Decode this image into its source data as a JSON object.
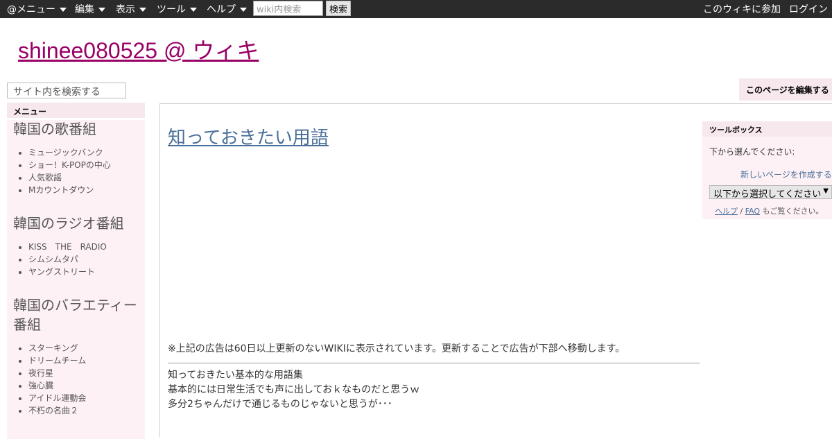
{
  "topbar": {
    "menus": [
      {
        "label": "@メニュー"
      },
      {
        "label": "編集"
      },
      {
        "label": "表示"
      },
      {
        "label": "ツール"
      },
      {
        "label": "ヘルプ"
      }
    ],
    "search_placeholder": "wiki内検索",
    "search_button": "検索",
    "join_label": "このウィキに参加",
    "login_label": "ログイン"
  },
  "site": {
    "title": "shinee080525 @ ウィキ"
  },
  "left_search": {
    "placeholder": "サイト内を検索する"
  },
  "edit_tab": {
    "label": "このページを編集する"
  },
  "sidebar": {
    "menu_label": "メニュー",
    "sections": [
      {
        "heading": "韓国の歌番組",
        "items": [
          "ミュージックバンク",
          "ショー！K-POPの中心",
          "人気歌謡",
          "Mカウントダウン"
        ]
      },
      {
        "heading": "韓国のラジオ番組",
        "items": [
          "KISS　THE　RADIO",
          "シムシムタパ",
          "ヤングストリート"
        ]
      },
      {
        "heading_line1": "韓国のバラエティー",
        "heading_line2": "番組",
        "items": [
          "スターキング",
          "ドリームチーム",
          "夜行星",
          "強心臓",
          "アイドル運動会",
          "不朽の名曲２"
        ]
      }
    ]
  },
  "main": {
    "title": "知っておきたい用語",
    "ad_note": "※上記の広告は60日以上更新のないWIKIに表示されています。更新することで広告が下部へ移動します。",
    "lines": [
      "知っておきたい基本的な用語集",
      "基本的には日常生活でも声に出しておｋなものだと思うｗ",
      "多分2ちゃんだけで通じるものじゃないと思うが･･･"
    ]
  },
  "toolbox": {
    "head": "ツールボックス",
    "label": "下から選んでください:",
    "new_page": "新しいページを作成する",
    "select_value": "以下から選択してください",
    "help_link": "ヘルプ",
    "separator": "/",
    "faq_link": "FAQ",
    "help_suffix": "もご覧ください。"
  }
}
